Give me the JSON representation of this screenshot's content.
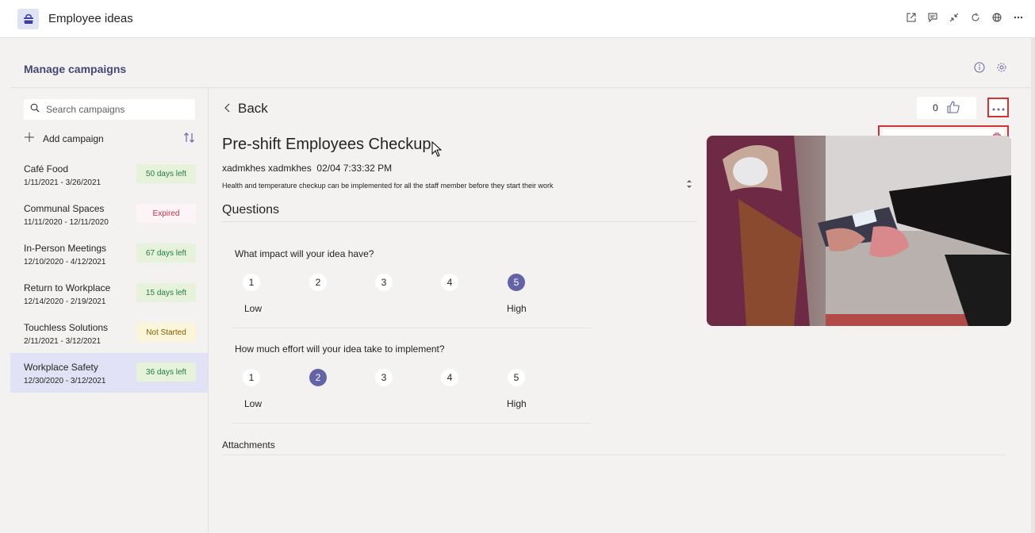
{
  "app": {
    "title": "Employee ideas"
  },
  "topbar_icons": [
    "popout-icon",
    "chat-icon",
    "collapse-icon",
    "refresh-icon",
    "globe-icon",
    "more-icon"
  ],
  "header": {
    "title": "Manage campaigns"
  },
  "sidebar": {
    "search_placeholder": "Search campaigns",
    "add_label": "Add campaign",
    "campaigns": [
      {
        "name": "Café Food",
        "dates": "1/11/2021 - 3/26/2021",
        "badge": "50 days left",
        "status": "green"
      },
      {
        "name": "Communal Spaces",
        "dates": "11/11/2020 - 12/11/2020",
        "badge": "Expired",
        "status": "red"
      },
      {
        "name": "In-Person Meetings",
        "dates": "12/10/2020 - 4/12/2021",
        "badge": "67 days left",
        "status": "green"
      },
      {
        "name": "Return to Workplace",
        "dates": "12/14/2020 - 2/19/2021",
        "badge": "15 days left",
        "status": "green"
      },
      {
        "name": "Touchless Solutions",
        "dates": "2/11/2021 - 3/12/2021",
        "badge": "Not Started",
        "status": "yellow"
      },
      {
        "name": "Workplace Safety",
        "dates": "12/30/2020 - 3/12/2021",
        "badge": "36 days left",
        "status": "green",
        "selected": true
      }
    ]
  },
  "main": {
    "back_label": "Back",
    "like_count": "0",
    "delete_label": "Delete",
    "idea_title": "Pre-shift Employees Checkup",
    "author": "xadmkhes xadmkhes",
    "timestamp": "02/04 7:33:32 PM",
    "description": "Health and temperature checkup can be implemented for all the staff member before they start their work",
    "questions_heading": "Questions",
    "questions": [
      {
        "text": "What impact will your idea have?",
        "options": [
          "1",
          "2",
          "3",
          "4",
          "5"
        ],
        "selected": 5,
        "low": "Low",
        "high": "High"
      },
      {
        "text": "How much effort will your idea take to implement?",
        "options": [
          "1",
          "2",
          "3",
          "4",
          "5"
        ],
        "selected": 2,
        "low": "Low",
        "high": "High"
      }
    ],
    "attachments_heading": "Attachments"
  },
  "colors": {
    "accent": "#6264a7",
    "highlight_border": "#d13438"
  }
}
